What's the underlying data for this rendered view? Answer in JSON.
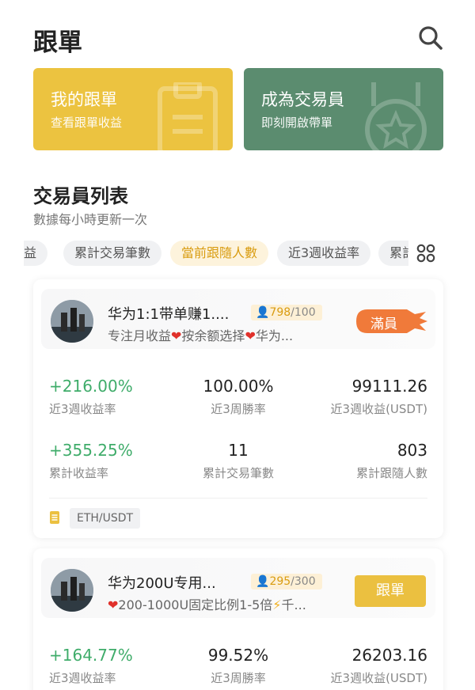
{
  "header": {
    "title": "跟單"
  },
  "cards": {
    "copy": {
      "title": "我的跟單",
      "subtitle": "查看跟單收益"
    },
    "trader": {
      "title": "成為交易員",
      "subtitle": "即刻開啟帶單"
    }
  },
  "section": {
    "title": "交易員列表",
    "subtitle": "數據每小時更新一次"
  },
  "filters": [
    "益",
    "累計交易筆數",
    "當前跟隨人數",
    "近3週收益率",
    "累計"
  ],
  "active_filter": "當前跟隨人數",
  "traders": [
    {
      "name": "华为1:1带单赚1....",
      "followers": "798",
      "max_followers": "/100",
      "desc_a": "专注月收益",
      "desc_b": "按余额选择",
      "desc_c": "华为...",
      "status": "滿員",
      "stats": [
        {
          "value": "+216.00%",
          "label": "近3週收益率"
        },
        {
          "value": "100.00%",
          "label": "近3周勝率"
        },
        {
          "value": "99111.26",
          "label": "近3週收益(USDT)"
        },
        {
          "value": "+355.25%",
          "label": "累計收益率"
        },
        {
          "value": "11",
          "label": "累計交易筆數"
        },
        {
          "value": "803",
          "label": "累計跟隨人數"
        }
      ],
      "pair": "ETH/USDT"
    },
    {
      "name": "华为200U专用...",
      "followers": "295",
      "max_followers": "/300",
      "desc_a": "200-1000U固定比例1-5倍",
      "desc_b": "千...",
      "action": "跟單",
      "stats": [
        {
          "value": "+164.77%",
          "label": "近3週收益率"
        },
        {
          "value": "99.52%",
          "label": "近3周勝率"
        },
        {
          "value": "26203.16",
          "label": "近3週收益(USDT)"
        }
      ]
    }
  ],
  "colors": {
    "gold": "#ECC340",
    "green_card": "#5B8C6F",
    "profit_green": "#3FAC6A",
    "full_red": "#F07A3A"
  }
}
